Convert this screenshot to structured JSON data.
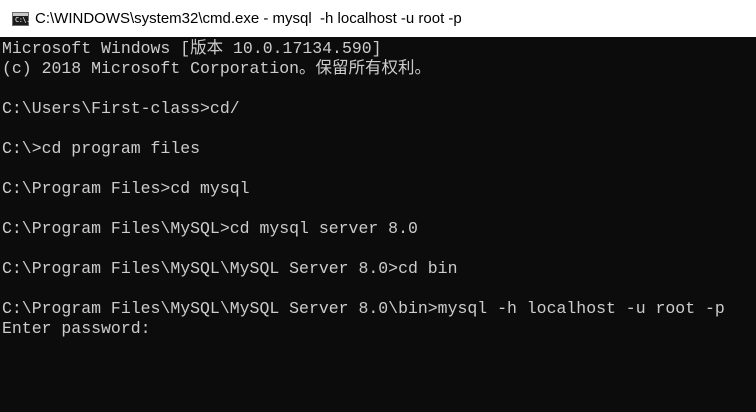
{
  "window": {
    "title": "C:\\WINDOWS\\system32\\cmd.exe - mysql  -h localhost -u root -p",
    "icon": "cmd-icon",
    "icon_glyph": "C:\\."
  },
  "colors": {
    "console_bg": "#0c0c0c",
    "console_text": "#cccccc",
    "titlebar_bg": "#ffffff"
  },
  "console": {
    "lines": [
      "Microsoft Windows [版本 10.0.17134.590]",
      "(c) 2018 Microsoft Corporation。保留所有权利。",
      "",
      "C:\\Users\\First-class>cd/",
      "",
      "C:\\>cd program files",
      "",
      "C:\\Program Files>cd mysql",
      "",
      "C:\\Program Files\\MySQL>cd mysql server 8.0",
      "",
      "C:\\Program Files\\MySQL\\MySQL Server 8.0>cd bin",
      "",
      "C:\\Program Files\\MySQL\\MySQL Server 8.0\\bin>mysql -h localhost -u root -p",
      "Enter password:"
    ]
  }
}
